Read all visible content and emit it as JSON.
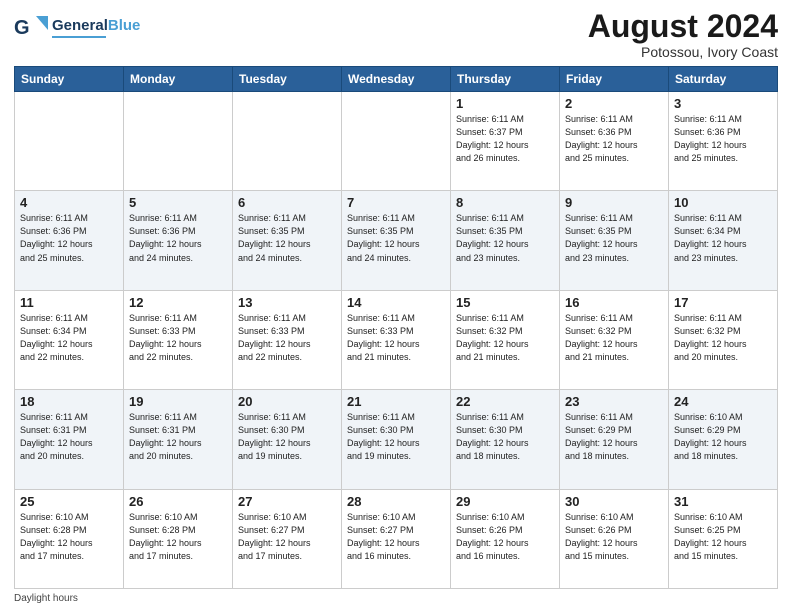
{
  "header": {
    "logo_general": "General",
    "logo_blue": "Blue",
    "month_year": "August 2024",
    "location": "Potossou, Ivory Coast"
  },
  "footer": {
    "daylight_label": "Daylight hours"
  },
  "weekdays": [
    "Sunday",
    "Monday",
    "Tuesday",
    "Wednesday",
    "Thursday",
    "Friday",
    "Saturday"
  ],
  "weeks": [
    [
      {
        "day": "",
        "info": ""
      },
      {
        "day": "",
        "info": ""
      },
      {
        "day": "",
        "info": ""
      },
      {
        "day": "",
        "info": ""
      },
      {
        "day": "1",
        "info": "Sunrise: 6:11 AM\nSunset: 6:37 PM\nDaylight: 12 hours\nand 26 minutes."
      },
      {
        "day": "2",
        "info": "Sunrise: 6:11 AM\nSunset: 6:36 PM\nDaylight: 12 hours\nand 25 minutes."
      },
      {
        "day": "3",
        "info": "Sunrise: 6:11 AM\nSunset: 6:36 PM\nDaylight: 12 hours\nand 25 minutes."
      }
    ],
    [
      {
        "day": "4",
        "info": "Sunrise: 6:11 AM\nSunset: 6:36 PM\nDaylight: 12 hours\nand 25 minutes."
      },
      {
        "day": "5",
        "info": "Sunrise: 6:11 AM\nSunset: 6:36 PM\nDaylight: 12 hours\nand 24 minutes."
      },
      {
        "day": "6",
        "info": "Sunrise: 6:11 AM\nSunset: 6:35 PM\nDaylight: 12 hours\nand 24 minutes."
      },
      {
        "day": "7",
        "info": "Sunrise: 6:11 AM\nSunset: 6:35 PM\nDaylight: 12 hours\nand 24 minutes."
      },
      {
        "day": "8",
        "info": "Sunrise: 6:11 AM\nSunset: 6:35 PM\nDaylight: 12 hours\nand 23 minutes."
      },
      {
        "day": "9",
        "info": "Sunrise: 6:11 AM\nSunset: 6:35 PM\nDaylight: 12 hours\nand 23 minutes."
      },
      {
        "day": "10",
        "info": "Sunrise: 6:11 AM\nSunset: 6:34 PM\nDaylight: 12 hours\nand 23 minutes."
      }
    ],
    [
      {
        "day": "11",
        "info": "Sunrise: 6:11 AM\nSunset: 6:34 PM\nDaylight: 12 hours\nand 22 minutes."
      },
      {
        "day": "12",
        "info": "Sunrise: 6:11 AM\nSunset: 6:33 PM\nDaylight: 12 hours\nand 22 minutes."
      },
      {
        "day": "13",
        "info": "Sunrise: 6:11 AM\nSunset: 6:33 PM\nDaylight: 12 hours\nand 22 minutes."
      },
      {
        "day": "14",
        "info": "Sunrise: 6:11 AM\nSunset: 6:33 PM\nDaylight: 12 hours\nand 21 minutes."
      },
      {
        "day": "15",
        "info": "Sunrise: 6:11 AM\nSunset: 6:32 PM\nDaylight: 12 hours\nand 21 minutes."
      },
      {
        "day": "16",
        "info": "Sunrise: 6:11 AM\nSunset: 6:32 PM\nDaylight: 12 hours\nand 21 minutes."
      },
      {
        "day": "17",
        "info": "Sunrise: 6:11 AM\nSunset: 6:32 PM\nDaylight: 12 hours\nand 20 minutes."
      }
    ],
    [
      {
        "day": "18",
        "info": "Sunrise: 6:11 AM\nSunset: 6:31 PM\nDaylight: 12 hours\nand 20 minutes."
      },
      {
        "day": "19",
        "info": "Sunrise: 6:11 AM\nSunset: 6:31 PM\nDaylight: 12 hours\nand 20 minutes."
      },
      {
        "day": "20",
        "info": "Sunrise: 6:11 AM\nSunset: 6:30 PM\nDaylight: 12 hours\nand 19 minutes."
      },
      {
        "day": "21",
        "info": "Sunrise: 6:11 AM\nSunset: 6:30 PM\nDaylight: 12 hours\nand 19 minutes."
      },
      {
        "day": "22",
        "info": "Sunrise: 6:11 AM\nSunset: 6:30 PM\nDaylight: 12 hours\nand 18 minutes."
      },
      {
        "day": "23",
        "info": "Sunrise: 6:11 AM\nSunset: 6:29 PM\nDaylight: 12 hours\nand 18 minutes."
      },
      {
        "day": "24",
        "info": "Sunrise: 6:10 AM\nSunset: 6:29 PM\nDaylight: 12 hours\nand 18 minutes."
      }
    ],
    [
      {
        "day": "25",
        "info": "Sunrise: 6:10 AM\nSunset: 6:28 PM\nDaylight: 12 hours\nand 17 minutes."
      },
      {
        "day": "26",
        "info": "Sunrise: 6:10 AM\nSunset: 6:28 PM\nDaylight: 12 hours\nand 17 minutes."
      },
      {
        "day": "27",
        "info": "Sunrise: 6:10 AM\nSunset: 6:27 PM\nDaylight: 12 hours\nand 17 minutes."
      },
      {
        "day": "28",
        "info": "Sunrise: 6:10 AM\nSunset: 6:27 PM\nDaylight: 12 hours\nand 16 minutes."
      },
      {
        "day": "29",
        "info": "Sunrise: 6:10 AM\nSunset: 6:26 PM\nDaylight: 12 hours\nand 16 minutes."
      },
      {
        "day": "30",
        "info": "Sunrise: 6:10 AM\nSunset: 6:26 PM\nDaylight: 12 hours\nand 15 minutes."
      },
      {
        "day": "31",
        "info": "Sunrise: 6:10 AM\nSunset: 6:25 PM\nDaylight: 12 hours\nand 15 minutes."
      }
    ]
  ]
}
